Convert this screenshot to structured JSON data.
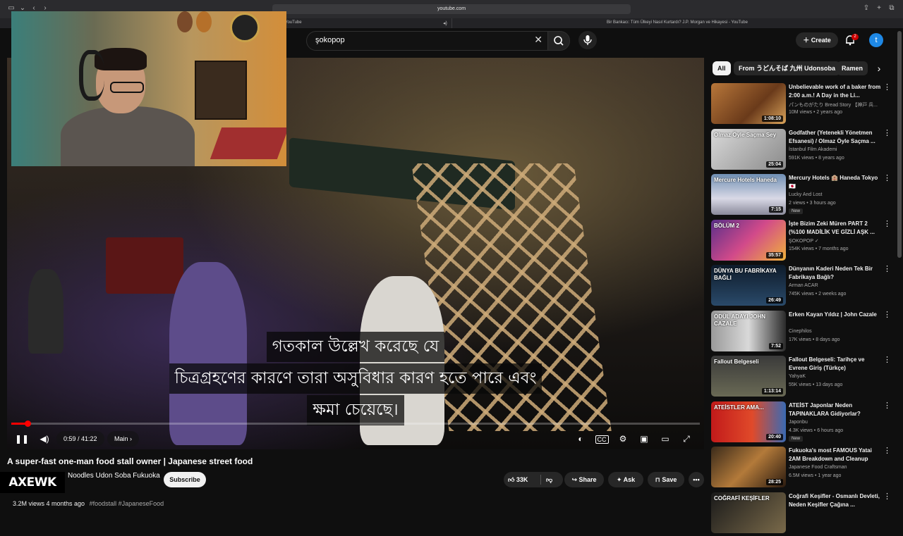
{
  "browser": {
    "url": "youtube.com",
    "tabs": [
      {
        "label": "YouTube"
      },
      {
        "label": "Bir Bankacı: Tüm Ülkeyi Nasıl Kurtardı? J.P. Morgan ve Hikayesi - YouTube"
      }
    ]
  },
  "header": {
    "search_value": "şokopop",
    "create_label": "Create",
    "notification_count": "2",
    "avatar_letter": "t"
  },
  "player": {
    "subtitles": [
      "গতকাল উল্লেখ করেছে যে",
      "চিত্রগ্রহণের কারণে তারা অসুবিধার কারণ হতে পারে এবং",
      "ক্ষমা চেয়েছে।"
    ],
    "time_current": "0:59",
    "time_total": "41:22",
    "time_display": "0:59 / 41:22",
    "chapter_label": "Main",
    "progress_fraction": 0.024
  },
  "video_info": {
    "title": "A super-fast one-man food stall owner | Japanese street food",
    "channel_logo_text": "AXEWK",
    "channel_name": "Noodles Udon Soba Fukuoka",
    "subscribe_label": "Subscribe",
    "likes": "33K",
    "share_label": "Share",
    "ask_label": "Ask",
    "save_label": "Save",
    "views": "3.2M views",
    "age": "4 months ago",
    "tags": "#foodstall #JapaneseFood"
  },
  "sidebar": {
    "chips": [
      "All",
      "From うどんそば 九州 Udonsoba",
      "Ramen"
    ],
    "recommendations": [
      {
        "title": "Unbelievable work of a baker from 2:00 a.m.! A Day in the Li...",
        "channel": "パンものがたり Bread Story  【神戸 兵...",
        "stats": "10M views • 2 years ago",
        "duration": "1:08:10",
        "caption": "",
        "new": ""
      },
      {
        "title": "Godfather (Yetenekli Yönetmen Efsanesi) / Olmaz Öyle Saçma ...",
        "channel": "İstanbul Film Akademi",
        "stats": "591K views • 8 years ago",
        "duration": "25:04",
        "caption": "Olmaz Öyle Saçma Sey",
        "new": ""
      },
      {
        "title": "Mercury Hotels 🏨 Haneda Tokyo 🇯🇵",
        "channel": "Lucky And Lost",
        "stats": "2 views • 3 hours ago",
        "duration": "7:15",
        "caption": "Mercure Hotels Haneda",
        "new": "New"
      },
      {
        "title": "İşte Bizim Zeki Müren PART 2 (%100 MADİLİK VE GİZLİ AŞK ...",
        "channel": "ŞOKOPOP ✓",
        "stats": "154K views • 7 months ago",
        "duration": "35:57",
        "caption": "BÖLÜM 2",
        "new": ""
      },
      {
        "title": "Dünyanın Kaderi Neden Tek Bir Fabrikaya Bağlı?",
        "channel": "Arman ACAR",
        "stats": "745K views • 2 weeks ago",
        "duration": "26:49",
        "caption": "DÜNYA BU FABRİKAYA BAĞLI",
        "new": ""
      },
      {
        "title": "Erken Kayan Yıldız | John Cazale",
        "channel": "Cinephilos",
        "stats": "17K views • 8 days ago",
        "duration": "7:52",
        "caption": "ÖDÜL ADAYI JOHN CAZALE",
        "new": ""
      },
      {
        "title": "Fallout Belgeseli: Tarihçe ve Evrene Giriş (Türkçe)",
        "channel": "YahyaK",
        "stats": "55K views • 13 days ago",
        "duration": "1:13:14",
        "caption": "Fallout Belgeseli",
        "new": ""
      },
      {
        "title": "ATEİST Japonlar Neden TAPINAKLARA Gidiyorlar?",
        "channel": "Japonbu",
        "stats": "4.3K views • 6 hours ago",
        "duration": "20:40",
        "caption": "ATEİSTLER AMA...",
        "new": "New"
      },
      {
        "title": "Fukuoka's most FAMOUS Yatai 2AM Breakdown and Cleanup",
        "channel": "Japanese Food Craftsman",
        "stats": "6.5M views • 1 year ago",
        "duration": "28:25",
        "caption": "",
        "new": ""
      },
      {
        "title": "Coğrafi Keşifler - Osmanlı Devleti, Neden Keşifler Çağına ...",
        "channel": "",
        "stats": "",
        "duration": "",
        "caption": "COĞRAFİ KEŞİFLER",
        "new": ""
      }
    ]
  },
  "colors": {
    "accent": "#ff0000",
    "background": "#0f0f0f",
    "avatar": "#1e88e5",
    "badge": "#cc0000"
  }
}
